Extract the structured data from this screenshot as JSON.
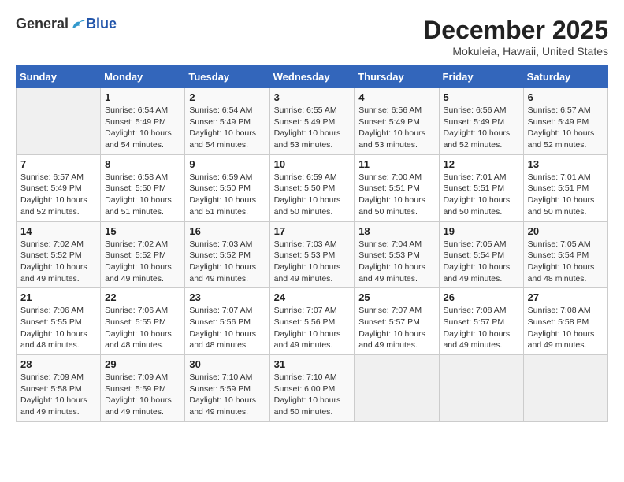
{
  "logo": {
    "general": "General",
    "blue": "Blue"
  },
  "title": "December 2025",
  "location": "Mokuleia, Hawaii, United States",
  "days_of_week": [
    "Sunday",
    "Monday",
    "Tuesday",
    "Wednesday",
    "Thursday",
    "Friday",
    "Saturday"
  ],
  "weeks": [
    [
      {
        "day": "",
        "info": ""
      },
      {
        "day": "1",
        "info": "Sunrise: 6:54 AM\nSunset: 5:49 PM\nDaylight: 10 hours\nand 54 minutes."
      },
      {
        "day": "2",
        "info": "Sunrise: 6:54 AM\nSunset: 5:49 PM\nDaylight: 10 hours\nand 54 minutes."
      },
      {
        "day": "3",
        "info": "Sunrise: 6:55 AM\nSunset: 5:49 PM\nDaylight: 10 hours\nand 53 minutes."
      },
      {
        "day": "4",
        "info": "Sunrise: 6:56 AM\nSunset: 5:49 PM\nDaylight: 10 hours\nand 53 minutes."
      },
      {
        "day": "5",
        "info": "Sunrise: 6:56 AM\nSunset: 5:49 PM\nDaylight: 10 hours\nand 52 minutes."
      },
      {
        "day": "6",
        "info": "Sunrise: 6:57 AM\nSunset: 5:49 PM\nDaylight: 10 hours\nand 52 minutes."
      }
    ],
    [
      {
        "day": "7",
        "info": "Sunrise: 6:57 AM\nSunset: 5:49 PM\nDaylight: 10 hours\nand 52 minutes."
      },
      {
        "day": "8",
        "info": "Sunrise: 6:58 AM\nSunset: 5:50 PM\nDaylight: 10 hours\nand 51 minutes."
      },
      {
        "day": "9",
        "info": "Sunrise: 6:59 AM\nSunset: 5:50 PM\nDaylight: 10 hours\nand 51 minutes."
      },
      {
        "day": "10",
        "info": "Sunrise: 6:59 AM\nSunset: 5:50 PM\nDaylight: 10 hours\nand 50 minutes."
      },
      {
        "day": "11",
        "info": "Sunrise: 7:00 AM\nSunset: 5:51 PM\nDaylight: 10 hours\nand 50 minutes."
      },
      {
        "day": "12",
        "info": "Sunrise: 7:01 AM\nSunset: 5:51 PM\nDaylight: 10 hours\nand 50 minutes."
      },
      {
        "day": "13",
        "info": "Sunrise: 7:01 AM\nSunset: 5:51 PM\nDaylight: 10 hours\nand 50 minutes."
      }
    ],
    [
      {
        "day": "14",
        "info": "Sunrise: 7:02 AM\nSunset: 5:52 PM\nDaylight: 10 hours\nand 49 minutes."
      },
      {
        "day": "15",
        "info": "Sunrise: 7:02 AM\nSunset: 5:52 PM\nDaylight: 10 hours\nand 49 minutes."
      },
      {
        "day": "16",
        "info": "Sunrise: 7:03 AM\nSunset: 5:52 PM\nDaylight: 10 hours\nand 49 minutes."
      },
      {
        "day": "17",
        "info": "Sunrise: 7:03 AM\nSunset: 5:53 PM\nDaylight: 10 hours\nand 49 minutes."
      },
      {
        "day": "18",
        "info": "Sunrise: 7:04 AM\nSunset: 5:53 PM\nDaylight: 10 hours\nand 49 minutes."
      },
      {
        "day": "19",
        "info": "Sunrise: 7:05 AM\nSunset: 5:54 PM\nDaylight: 10 hours\nand 49 minutes."
      },
      {
        "day": "20",
        "info": "Sunrise: 7:05 AM\nSunset: 5:54 PM\nDaylight: 10 hours\nand 48 minutes."
      }
    ],
    [
      {
        "day": "21",
        "info": "Sunrise: 7:06 AM\nSunset: 5:55 PM\nDaylight: 10 hours\nand 48 minutes."
      },
      {
        "day": "22",
        "info": "Sunrise: 7:06 AM\nSunset: 5:55 PM\nDaylight: 10 hours\nand 48 minutes."
      },
      {
        "day": "23",
        "info": "Sunrise: 7:07 AM\nSunset: 5:56 PM\nDaylight: 10 hours\nand 48 minutes."
      },
      {
        "day": "24",
        "info": "Sunrise: 7:07 AM\nSunset: 5:56 PM\nDaylight: 10 hours\nand 49 minutes."
      },
      {
        "day": "25",
        "info": "Sunrise: 7:07 AM\nSunset: 5:57 PM\nDaylight: 10 hours\nand 49 minutes."
      },
      {
        "day": "26",
        "info": "Sunrise: 7:08 AM\nSunset: 5:57 PM\nDaylight: 10 hours\nand 49 minutes."
      },
      {
        "day": "27",
        "info": "Sunrise: 7:08 AM\nSunset: 5:58 PM\nDaylight: 10 hours\nand 49 minutes."
      }
    ],
    [
      {
        "day": "28",
        "info": "Sunrise: 7:09 AM\nSunset: 5:58 PM\nDaylight: 10 hours\nand 49 minutes."
      },
      {
        "day": "29",
        "info": "Sunrise: 7:09 AM\nSunset: 5:59 PM\nDaylight: 10 hours\nand 49 minutes."
      },
      {
        "day": "30",
        "info": "Sunrise: 7:10 AM\nSunset: 5:59 PM\nDaylight: 10 hours\nand 49 minutes."
      },
      {
        "day": "31",
        "info": "Sunrise: 7:10 AM\nSunset: 6:00 PM\nDaylight: 10 hours\nand 50 minutes."
      },
      {
        "day": "",
        "info": ""
      },
      {
        "day": "",
        "info": ""
      },
      {
        "day": "",
        "info": ""
      }
    ]
  ]
}
